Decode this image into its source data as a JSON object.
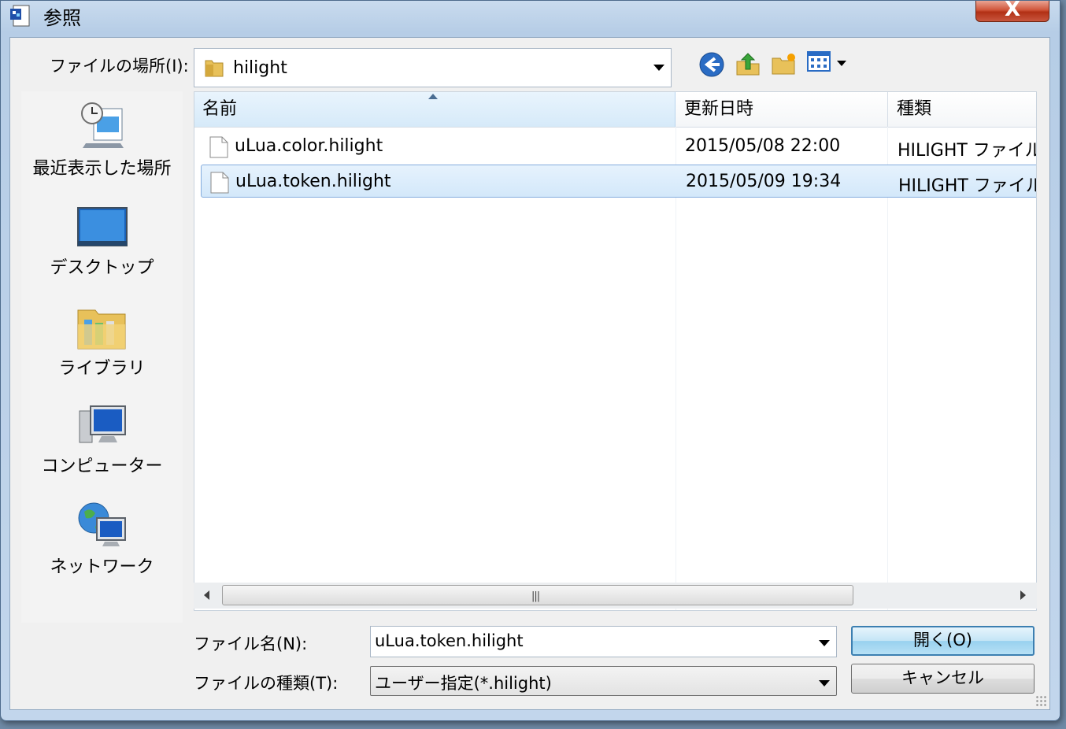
{
  "window": {
    "title": "参照",
    "close_label": "X"
  },
  "toolbar": {
    "lookin_label": "ファイルの場所(I):",
    "lookin_value": "hilight"
  },
  "places": [
    {
      "label": "最近表示した場所",
      "icon": "recent-places-icon"
    },
    {
      "label": "デスクトップ",
      "icon": "desktop-icon"
    },
    {
      "label": "ライブラリ",
      "icon": "libraries-icon"
    },
    {
      "label": "コンピューター",
      "icon": "computer-icon"
    },
    {
      "label": "ネットワーク",
      "icon": "network-icon"
    }
  ],
  "list": {
    "columns": [
      "名前",
      "更新日時",
      "種類"
    ],
    "rows": [
      {
        "name": "uLua.color.hilight",
        "date": "2015/05/08 22:00",
        "type": "HILIGHT ファイル",
        "selected": false
      },
      {
        "name": "uLua.token.hilight",
        "date": "2015/05/09 19:34",
        "type": "HILIGHT ファイル",
        "selected": true
      }
    ]
  },
  "footer": {
    "filename_label": "ファイル名(N):",
    "filename_value": "uLua.token.hilight",
    "filetype_label": "ファイルの種類(T):",
    "filetype_value": "ユーザー指定(*.hilight)",
    "open_label": "開く(O)",
    "cancel_label": "キャンセル"
  },
  "colors": {
    "accent": "#3c7fb1",
    "selection": "#d3e8fa",
    "close": "#c8563e"
  }
}
